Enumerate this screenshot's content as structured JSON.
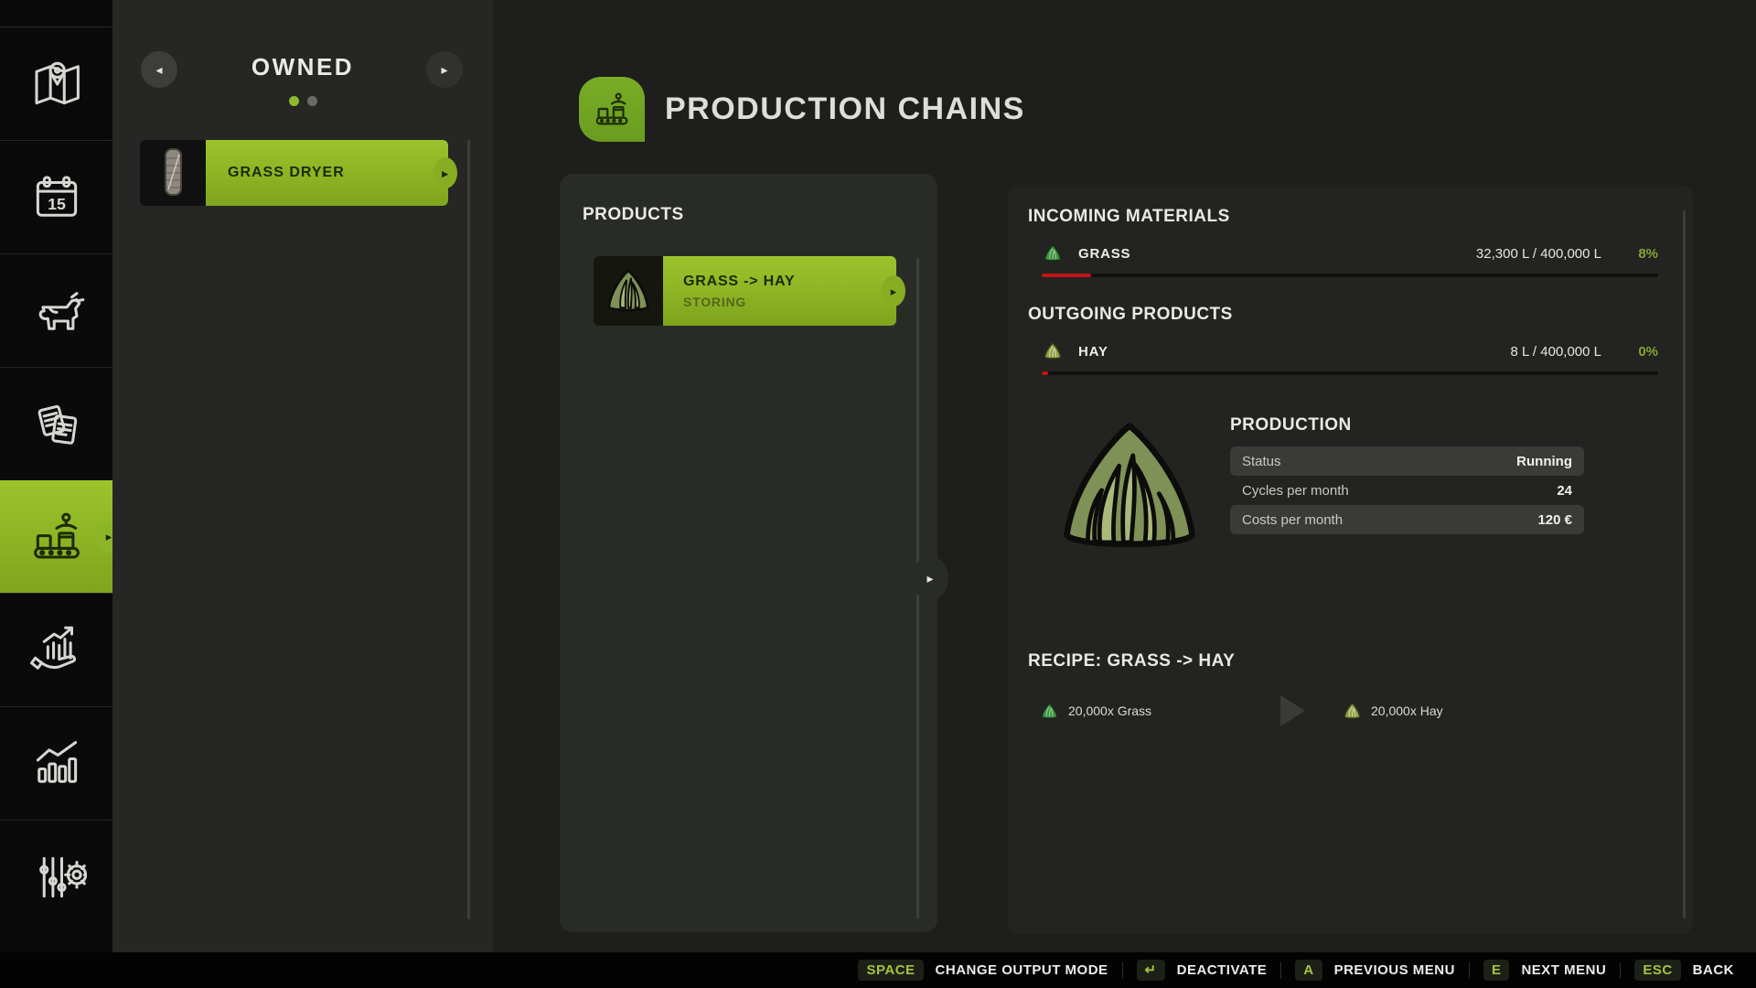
{
  "owned_panel": {
    "title": "OWNED",
    "item_label": "GRASS DRYER"
  },
  "header": {
    "title": "PRODUCTION CHAINS"
  },
  "products_panel": {
    "title": "PRODUCTS",
    "item": {
      "label": "GRASS -> HAY",
      "status": "STORING"
    }
  },
  "details": {
    "incoming_title": "INCOMING MATERIALS",
    "incoming": [
      {
        "name": "GRASS",
        "amount": "32,300 L / 400,000 L",
        "percent": "8%",
        "fill_pct": 8
      }
    ],
    "outgoing_title": "OUTGOING PRODUCTS",
    "outgoing": [
      {
        "name": "HAY",
        "amount": "8 L / 400,000 L",
        "percent": "0%",
        "fill_pct": 1
      }
    ],
    "production": {
      "title": "PRODUCTION",
      "rows": [
        {
          "label": "Status",
          "value": "Running"
        },
        {
          "label": "Cycles per month",
          "value": "24"
        },
        {
          "label": "Costs per month",
          "value": "120 €"
        }
      ]
    },
    "recipe": {
      "title": "RECIPE: GRASS -> HAY",
      "input": "20,000x Grass",
      "output": "20,000x Hay"
    }
  },
  "bottom_bar": {
    "items": [
      {
        "key": "SPACE",
        "label": "CHANGE OUTPUT MODE"
      },
      {
        "key": "↵",
        "label": "DEACTIVATE"
      },
      {
        "key": "A",
        "label": "PREVIOUS MENU"
      },
      {
        "key": "E",
        "label": "NEXT MENU"
      },
      {
        "key": "ESC",
        "label": "BACK"
      }
    ]
  },
  "icons": {
    "arrow_left": "◂",
    "arrow_right": "▸"
  },
  "colors": {
    "accent": "#8fb92e",
    "progress_red": "#c41414",
    "percent_green": "#84a52f"
  }
}
